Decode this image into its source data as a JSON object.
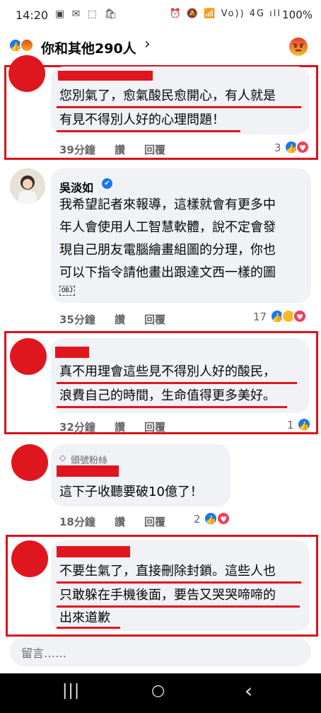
{
  "status_bar": {
    "time": "14:20",
    "left_icons": "▣ ✉ ⬚ 🛍",
    "right_icons": "⏰ 🔕 📶 Vo)) 4G ıll",
    "battery": "100%"
  },
  "header": {
    "title": "你和其他290人",
    "chevron": "›",
    "reaction_icons": [
      "like-icon",
      "angry-icon"
    ],
    "right_reaction_icon": "angry-icon"
  },
  "comments": [
    {
      "author": "",
      "text_lines": [
        "您別氣了，愈氣酸民愈開心，有人就是",
        "有見不得別人好的心理問題！"
      ],
      "time": "39分鐘",
      "like_label": "讚",
      "reply_label": "回覆",
      "reaction_count": "3",
      "reaction_icons": [
        "like-icon",
        "heart-icon"
      ]
    },
    {
      "author": "吳淡如",
      "verified": "✔",
      "text_lines": [
        "我希望記者來報導，這樣就會有更多中",
        "年人會使用人工智慧軟體，說不定會發",
        "現自己朋友電腦繪畫組圖的分理，你也",
        "可以下指令請他畫出跟達文西一樣的圖",
        "OBJ"
      ],
      "time": "35分鐘",
      "like_label": "讚",
      "reply_label": "回覆",
      "reaction_count": "17",
      "reaction_icons": [
        "like-icon",
        "haha-icon",
        "heart-icon"
      ]
    },
    {
      "author": "",
      "text_lines": [
        "真不用理會這些見不得別人好的酸民，",
        "浪費自己的時間，生命值得更多美好。"
      ],
      "time": "32分鐘",
      "like_label": "讚",
      "reply_label": "回覆",
      "reaction_count": "1",
      "reaction_icons": [
        "like-icon"
      ]
    },
    {
      "author": "",
      "badge": "頭號粉絲",
      "badge_icon": "diamond-icon",
      "text_lines": [
        "這下子收聽要破10億了！"
      ],
      "time": "18分鐘",
      "like_label": "讚",
      "reply_label": "回覆",
      "reaction_count": "2",
      "reaction_icons": [
        "like-icon",
        "heart-icon"
      ]
    },
    {
      "author": "",
      "text_lines": [
        "不要生氣了，直接刪除封鎖。這些人也",
        "只敢躲在手機後面，要告又哭哭啼啼的",
        "出來道歉"
      ]
    }
  ],
  "composer": {
    "placeholder": "留言……"
  },
  "nav": {
    "recents": "|||",
    "home": "○",
    "back": "‹"
  },
  "colors": {
    "redaction": "#e0161f",
    "highlight_frame": "#d7141c",
    "bubble": "#f0f2f5",
    "like_blue": "#1877f2"
  }
}
